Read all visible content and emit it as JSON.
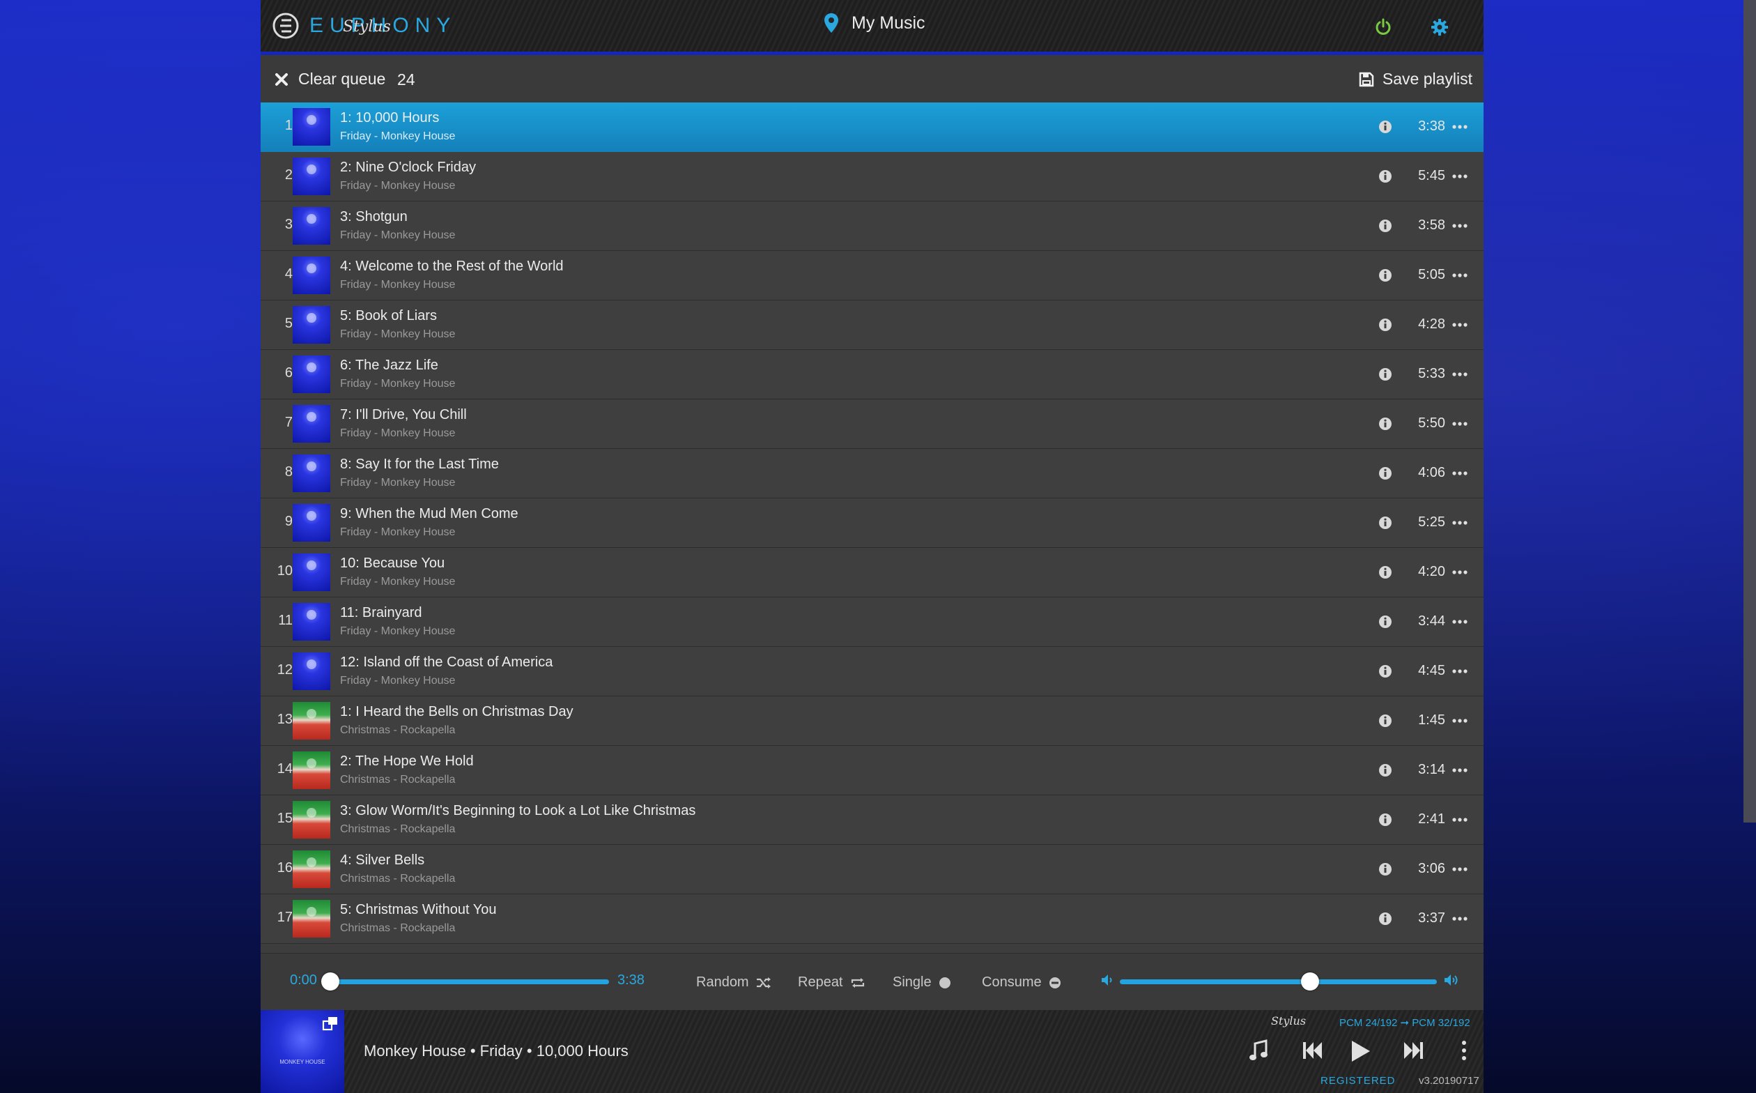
{
  "header": {
    "logo_text": "EUPHONY",
    "logo_script": "Stylus",
    "location_label": "My Music"
  },
  "toolbar": {
    "clear_label": "Clear queue",
    "queue_count": "24",
    "save_label": "Save playlist"
  },
  "queue": [
    {
      "num": "1",
      "title": "1: 10,000 Hours",
      "sub": "Friday - Monkey House",
      "dur": "3:38",
      "art": "blue",
      "active": true
    },
    {
      "num": "2",
      "title": "2: Nine O'clock Friday",
      "sub": "Friday - Monkey House",
      "dur": "5:45",
      "art": "blue"
    },
    {
      "num": "3",
      "title": "3: Shotgun",
      "sub": "Friday - Monkey House",
      "dur": "3:58",
      "art": "blue"
    },
    {
      "num": "4",
      "title": "4: Welcome to the Rest of the World",
      "sub": "Friday - Monkey House",
      "dur": "5:05",
      "art": "blue"
    },
    {
      "num": "5",
      "title": "5: Book of Liars",
      "sub": "Friday - Monkey House",
      "dur": "4:28",
      "art": "blue"
    },
    {
      "num": "6",
      "title": "6: The Jazz Life",
      "sub": "Friday - Monkey House",
      "dur": "5:33",
      "art": "blue"
    },
    {
      "num": "7",
      "title": "7: I'll Drive, You Chill",
      "sub": "Friday - Monkey House",
      "dur": "5:50",
      "art": "blue"
    },
    {
      "num": "8",
      "title": "8: Say It for the Last Time",
      "sub": "Friday - Monkey House",
      "dur": "4:06",
      "art": "blue"
    },
    {
      "num": "9",
      "title": "9: When the Mud Men Come",
      "sub": "Friday - Monkey House",
      "dur": "5:25",
      "art": "blue"
    },
    {
      "num": "10",
      "title": "10: Because You",
      "sub": "Friday - Monkey House",
      "dur": "4:20",
      "art": "blue"
    },
    {
      "num": "11",
      "title": "11: Brainyard",
      "sub": "Friday - Monkey House",
      "dur": "3:44",
      "art": "blue"
    },
    {
      "num": "12",
      "title": "12: Island off the Coast of America",
      "sub": "Friday - Monkey House",
      "dur": "4:45",
      "art": "blue"
    },
    {
      "num": "13",
      "title": "1: I Heard the Bells on Christmas Day",
      "sub": "Christmas - Rockapella",
      "dur": "1:45",
      "art": "xmas"
    },
    {
      "num": "14",
      "title": "2: The Hope We Hold",
      "sub": "Christmas - Rockapella",
      "dur": "3:14",
      "art": "xmas"
    },
    {
      "num": "15",
      "title": "3: Glow Worm/It's Beginning to Look a Lot Like Christmas",
      "sub": "Christmas - Rockapella",
      "dur": "2:41",
      "art": "xmas"
    },
    {
      "num": "16",
      "title": "4: Silver Bells",
      "sub": "Christmas - Rockapella",
      "dur": "3:06",
      "art": "xmas"
    },
    {
      "num": "17",
      "title": "5: Christmas Without You",
      "sub": "Christmas - Rockapella",
      "dur": "3:37",
      "art": "xmas"
    }
  ],
  "player": {
    "time_current": "0:00",
    "time_total": "3:38",
    "progress": 0.0,
    "volume": 0.6,
    "random_label": "Random",
    "repeat_label": "Repeat",
    "single_label": "Single",
    "consume_label": "Consume"
  },
  "now_playing": {
    "text": "Monkey House • Friday • 10,000 Hours",
    "cover_caption": "MONKEY HOUSE",
    "stylus_label": "Stylus",
    "format": "PCM 24/192 ➞ PCM 32/192",
    "registered": "REGISTERED",
    "version": "v3.20190717"
  },
  "colors": {
    "accent": "#2aa8e0",
    "active_row": "#1a94cf",
    "power": "#7ac943"
  },
  "icons": [
    "pin-icon",
    "power-icon",
    "gear-icon",
    "x-icon",
    "floppy-icon",
    "info-icon",
    "more-icon",
    "shuffle-icon",
    "repeat-icon",
    "volume-low-icon",
    "volume-high-icon",
    "music-note-icon",
    "prev-icon",
    "play-icon",
    "next-icon",
    "kebab-icon",
    "expand-icon"
  ]
}
